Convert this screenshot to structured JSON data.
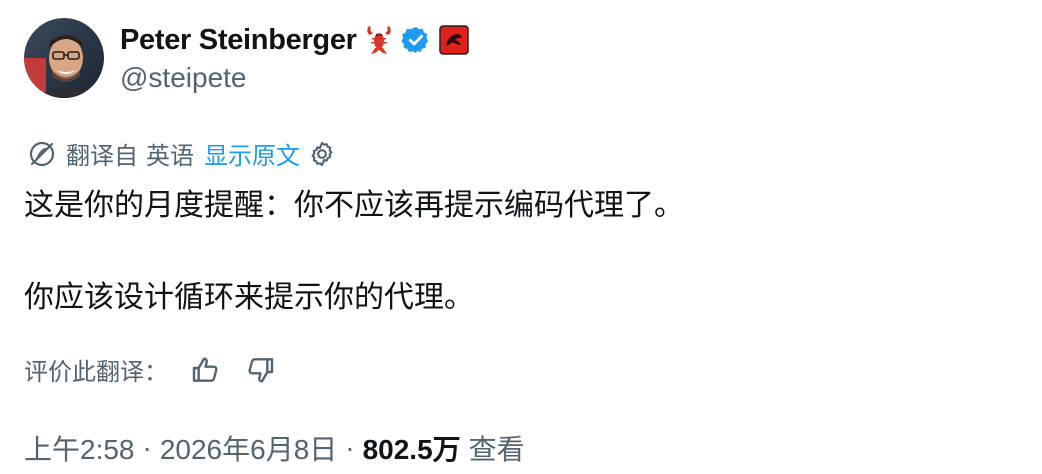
{
  "author": {
    "display_name": "Peter Steinberger",
    "handle": "@steipete",
    "emoji_icon": "lobster-icon",
    "verified_icon": "verified-badge-icon",
    "affiliate_icon": "red-badge-icon",
    "verified_color": "#1d9bf0"
  },
  "translation": {
    "translated_from": "翻译自",
    "language": "英语",
    "show_original": "显示原文"
  },
  "tweet": {
    "line1": "这是你的月度提醒：你不应该再提示编码代理了。",
    "line2": "你应该设计循环来提示你的代理。"
  },
  "rate": {
    "label": "评价此翻译："
  },
  "meta": {
    "time": "上午2:58",
    "date": "2026年6月8日",
    "views_count": "802.5万",
    "views_label": "查看",
    "separator": "·"
  },
  "colors": {
    "text": "#0f1419",
    "secondary": "#536471",
    "link": "#1d9bf0"
  }
}
